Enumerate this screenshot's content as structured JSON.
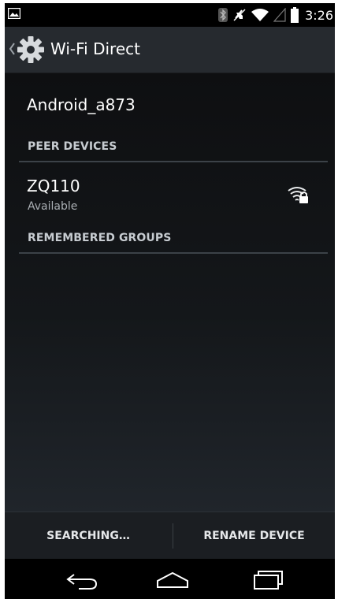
{
  "status_bar": {
    "time": "3:26",
    "icons": [
      "image-icon",
      "bluetooth-icon",
      "mute-icon",
      "wifi-icon",
      "signal-icon",
      "battery-icon"
    ]
  },
  "action_bar": {
    "title": "Wi-Fi Direct",
    "icon": "settings-gear-icon"
  },
  "this_device": {
    "name": "Android_a873"
  },
  "sections": {
    "peer_devices": "PEER DEVICES",
    "remembered_groups": "REMEMBERED GROUPS"
  },
  "peers": [
    {
      "name": "ZQ110",
      "status": "Available",
      "icon": "wifi-lock-icon"
    }
  ],
  "buttons": {
    "searching": "SEARCHING…",
    "rename": "RENAME DEVICE"
  },
  "nav": {
    "icons": [
      "back-icon",
      "home-icon",
      "recents-icon"
    ]
  },
  "colors": {
    "action_bar": "#262a2f",
    "section_text": "#c7ccd1",
    "divider": "#3c4248"
  }
}
